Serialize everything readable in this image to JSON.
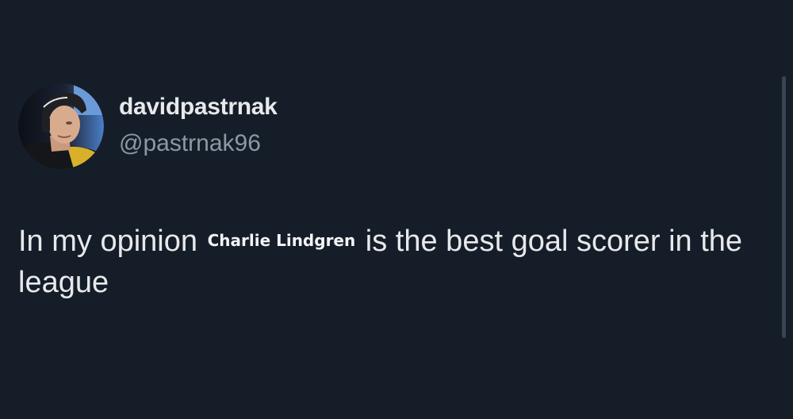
{
  "author": {
    "display_name": "davidpastrnak",
    "handle": "@pastrnak96",
    "avatar_icon": "player-avatar"
  },
  "tweet": {
    "text_before": "In my opinion",
    "overlay_name": "Charlie Lindgren",
    "text_after": "is the best goal scorer in the league"
  },
  "colors": {
    "background": "#151d29",
    "primary_text": "#e7e9ea",
    "secondary_text": "#8b98a5"
  }
}
